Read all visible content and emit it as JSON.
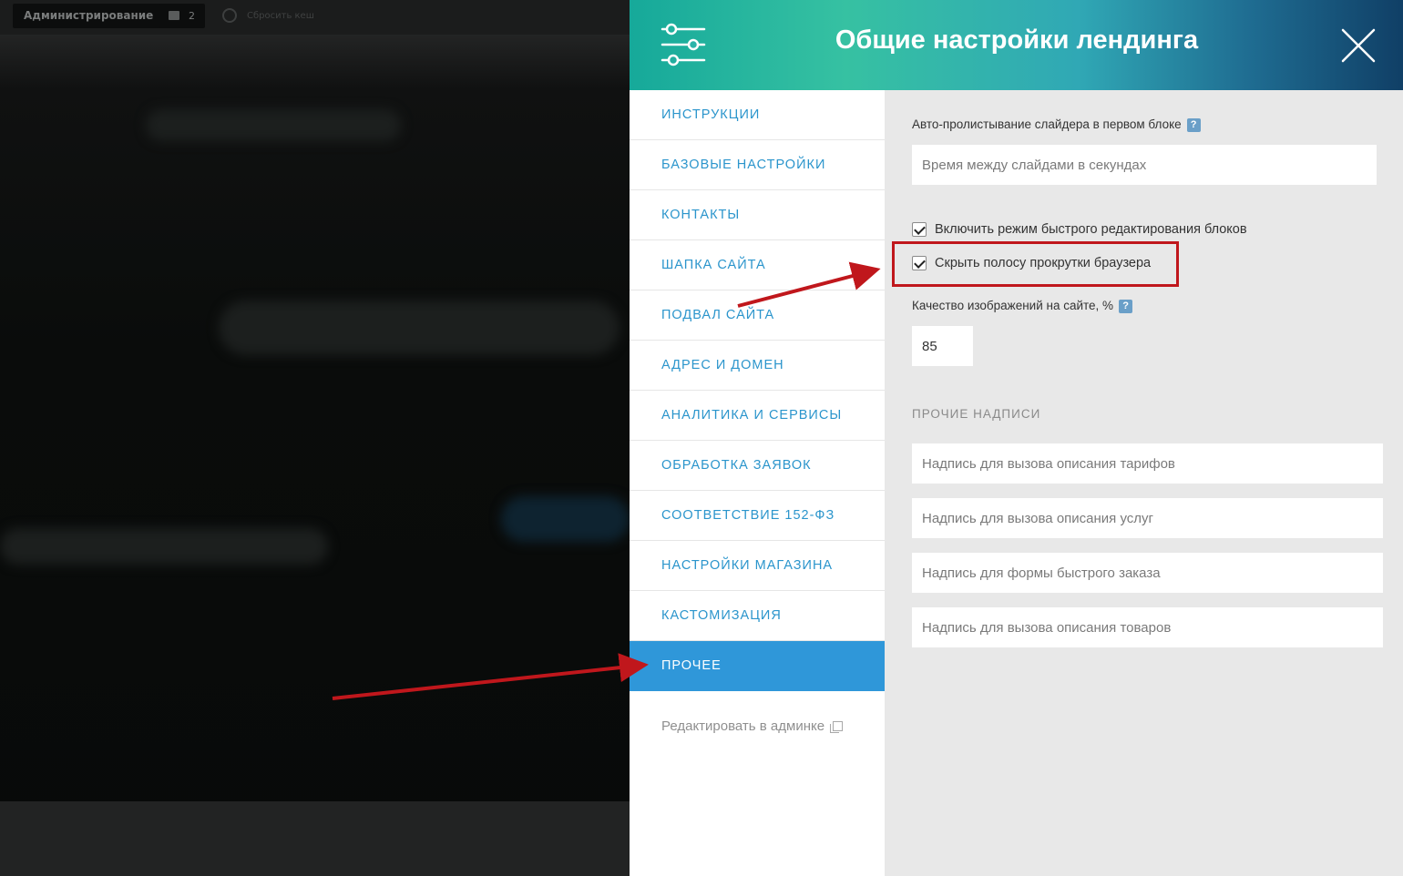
{
  "background": {
    "admin_button": "Администрирование",
    "comments_count": "2",
    "clear_cache": "Сбросить кеш"
  },
  "panel": {
    "title": "Общие настройки лендинга",
    "header_gradient": [
      "#16a99a",
      "#36c1a2",
      "#30a8b5",
      "#1f6d92",
      "#103f66"
    ],
    "icons": {
      "settings": "sliders-icon",
      "close": "close-icon"
    }
  },
  "sidebar": {
    "items": [
      {
        "label": "ИНСТРУКЦИИ",
        "active": false
      },
      {
        "label": "БАЗОВЫЕ НАСТРОЙКИ",
        "active": false
      },
      {
        "label": "КОНТАКТЫ",
        "active": false
      },
      {
        "label": "ШАПКА САЙТА",
        "active": false
      },
      {
        "label": "ПОДВАЛ САЙТА",
        "active": false
      },
      {
        "label": "АДРЕС И ДОМЕН",
        "active": false
      },
      {
        "label": "АНАЛИТИКА И СЕРВИСЫ",
        "active": false
      },
      {
        "label": "ОБРАБОТКА ЗАЯВОК",
        "active": false
      },
      {
        "label": "СООТВЕТСТВИЕ 152-ФЗ",
        "active": false
      },
      {
        "label": "НАСТРОЙКИ МАГАЗИНА",
        "active": false
      },
      {
        "label": "КАСТОМИЗАЦИЯ",
        "active": false
      },
      {
        "label": "ПРОЧЕЕ",
        "active": true
      }
    ],
    "edit_admin_link": "Редактировать в админке",
    "accent_color": "#2f97d9"
  },
  "content": {
    "slider_autoplay": {
      "label": "Авто-пролистывание слайдера в первом блоке",
      "help": "?",
      "placeholder": "Время между слайдами в секундах",
      "value": ""
    },
    "quick_edit_checkbox": {
      "label": "Включить режим быстрого редактирования блоков",
      "checked": true
    },
    "hide_scrollbar_checkbox": {
      "label": "Скрыть полосу прокрутки браузера",
      "checked": true
    },
    "image_quality": {
      "label": "Качество изображений на сайте, %",
      "help": "?",
      "value": "85"
    },
    "other_labels": {
      "section_title": "ПРОЧИЕ НАДПИСИ",
      "fields": [
        {
          "placeholder": "Надпись для вызова описания тарифов"
        },
        {
          "placeholder": "Надпись для вызова описания услуг"
        },
        {
          "placeholder": "Надпись для формы быстрого заказа"
        },
        {
          "placeholder": "Надпись для вызова описания товаров"
        }
      ]
    }
  },
  "annotation": {
    "color": "#c0171c"
  }
}
